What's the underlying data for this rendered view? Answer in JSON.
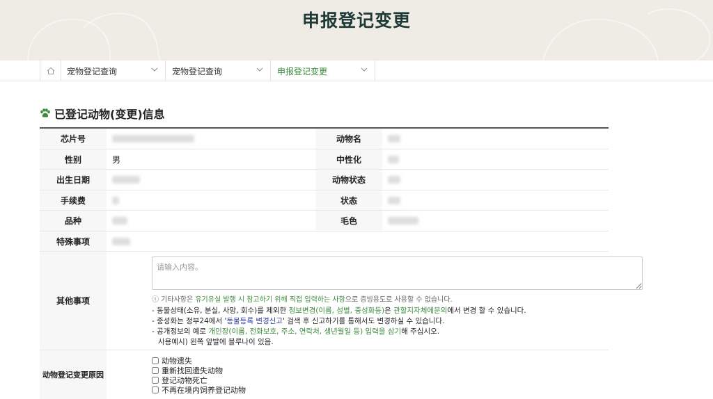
{
  "banner": {
    "title": "申报登记变更"
  },
  "breadcrumb": {
    "items": [
      {
        "label": "宠物登记查询"
      },
      {
        "label": "宠物登记查询"
      },
      {
        "label": "申报登记变更",
        "active": true
      }
    ]
  },
  "section": {
    "title": "已登记动物(变更)信息"
  },
  "table": {
    "chip_label": "芯片号",
    "name_label": "动物名",
    "sex_label": "性别",
    "sex_value": "男",
    "neuter_label": "中性化",
    "birth_label": "出生日期",
    "animal_status_label": "动物状态",
    "fee_label": "手续费",
    "status_label": "状态",
    "breed_label": "品种",
    "color_label": "毛色",
    "special_label": "特殊事项",
    "other_label": "其他事项",
    "other_placeholder": "请输入内容。",
    "reason_label": "动物登记变更原因"
  },
  "hint": {
    "p1": "ⓘ 기타사항은 ",
    "g1": "유기유실 발행 시 참고하기 위해 직접 입력하는 사항",
    "p2": "으로 증빙용도로 사용할 수 없습니다."
  },
  "bullets": {
    "b1_a": "- 동물상태(소유, 분실, 사망, 회수)를 제외한 ",
    "b1_g1": "정보변경(이름, 성별, 중성화등)",
    "b1_b": "은 ",
    "b1_g2": "관할지자체에문의",
    "b1_c": "에서 변경 할 수 있습니다.",
    "b2_a": "- 중성화는 정부24에서 '",
    "b2_blue": "동물등록 변경신고",
    "b2_c": "' 검색 후 신고하기를 통해서도 변경하실 수 있습니다.",
    "b3_a": "- 공개정보의 예로 ",
    "b3_g": "개인장(이름, 전화보호, 주소, 연락처, 생년월일 등) 입력을 삼기",
    "b3_c": "해 주십시오.",
    "b4": "사용예시) 왼쪽 앞발에 블루나이 있음."
  },
  "reasons": [
    {
      "label": "动物遗失"
    },
    {
      "label": "重新找回遗失动物"
    },
    {
      "label": "登记动物死亡"
    },
    {
      "label": "不再在境内饲养登记动物"
    }
  ],
  "colors": {
    "accent": "#3d8b3d",
    "banner_bg": "#efece6",
    "title": "#1f3a36"
  }
}
